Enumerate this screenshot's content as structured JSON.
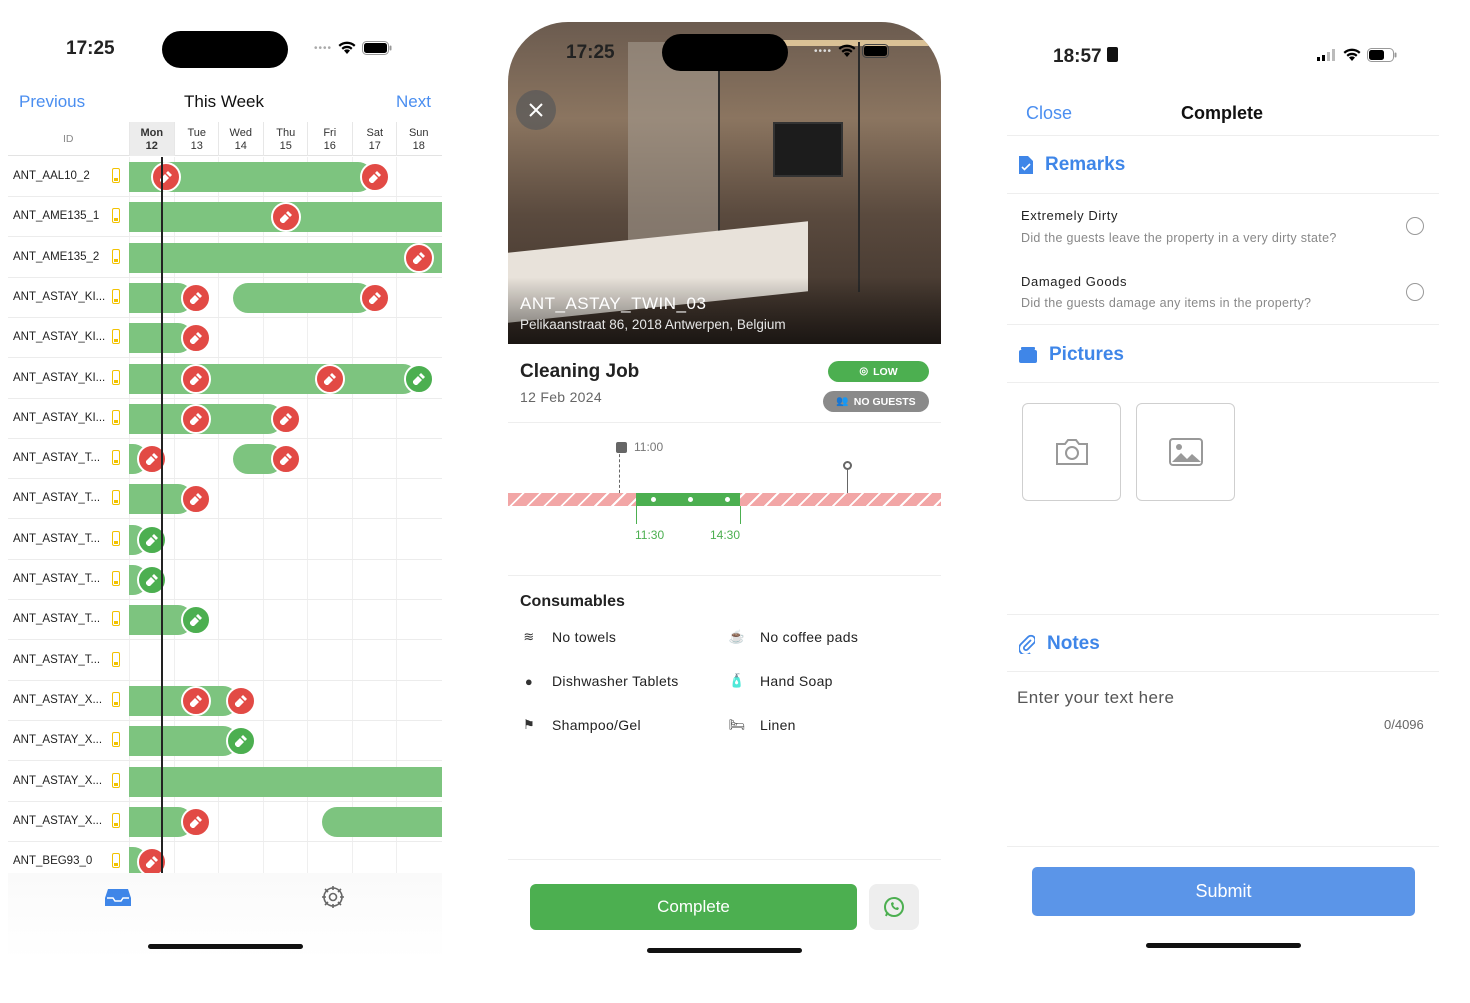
{
  "screen1": {
    "status_time": "17:25",
    "nav": {
      "prev": "Previous",
      "title": "This Week",
      "next": "Next"
    },
    "id_header": "ID",
    "days": [
      {
        "name": "Mon",
        "num": "12"
      },
      {
        "name": "Tue",
        "num": "13"
      },
      {
        "name": "Wed",
        "num": "14"
      },
      {
        "name": "Thu",
        "num": "15"
      },
      {
        "name": "Fri",
        "num": "16"
      },
      {
        "name": "Sat",
        "num": "17"
      },
      {
        "name": "Sun",
        "num": "18"
      }
    ],
    "rows": [
      {
        "id": "ANT_AAL10_2"
      },
      {
        "id": "ANT_AME135_1"
      },
      {
        "id": "ANT_AME135_2"
      },
      {
        "id": "ANT_ASTAY_KI..."
      },
      {
        "id": "ANT_ASTAY_KI..."
      },
      {
        "id": "ANT_ASTAY_KI..."
      },
      {
        "id": "ANT_ASTAY_KI..."
      },
      {
        "id": "ANT_ASTAY_T..."
      },
      {
        "id": "ANT_ASTAY_T..."
      },
      {
        "id": "ANT_ASTAY_T..."
      },
      {
        "id": "ANT_ASTAY_T..."
      },
      {
        "id": "ANT_ASTAY_T..."
      },
      {
        "id": "ANT_ASTAY_T..."
      },
      {
        "id": "ANT_ASTAY_X..."
      },
      {
        "id": "ANT_ASTAY_X..."
      },
      {
        "id": "ANT_ASTAY_X..."
      },
      {
        "id": "ANT_ASTAY_X..."
      },
      {
        "id": "ANT_BEG93_0"
      }
    ],
    "tabs": [
      {
        "icon": "inbox-icon"
      },
      {
        "icon": "gear-icon"
      }
    ]
  },
  "screen2": {
    "status_time": "17:25",
    "property_name": "ANT_ASTAY_TWIN_03",
    "address": "Pelikaanstraat 86, 2018 Antwerpen, Belgium",
    "job_title": "Cleaning Job",
    "job_date": "12 Feb 2024",
    "priority_badge": "LOW",
    "guests_badge": "NO GUESTS",
    "checkout_time": "11:00",
    "window_start": "11:30",
    "window_end": "14:30",
    "consumables_title": "Consumables",
    "consumables": [
      {
        "label": "No towels",
        "icon": "towels-icon"
      },
      {
        "label": "No coffee pads",
        "icon": "coffee-icon"
      },
      {
        "label": "Dishwasher Tablets",
        "icon": "tablets-icon"
      },
      {
        "label": "Hand Soap",
        "icon": "soap-icon"
      },
      {
        "label": "Shampoo/Gel",
        "icon": "shampoo-icon"
      },
      {
        "label": "Linen",
        "icon": "bed-icon"
      }
    ],
    "complete_label": "Complete",
    "colors": {
      "green": "#4caf50",
      "pink": "#f2a6a6"
    }
  },
  "screen3": {
    "status_time": "18:57",
    "nav": {
      "close": "Close",
      "title": "Complete"
    },
    "remarks_title": "Remarks",
    "remarks": [
      {
        "title": "Extremely Dirty",
        "desc": "Did the guests leave the property in a very dirty state?"
      },
      {
        "title": "Damaged Goods",
        "desc": "Did the guests damage any items in the property?"
      }
    ],
    "pictures_title": "Pictures",
    "notes_title": "Notes",
    "notes_placeholder": "Enter your text here",
    "notes_counter": "0/4096",
    "submit_label": "Submit",
    "colors": {
      "accent": "#3f86e8",
      "submit": "#5b95e8"
    }
  }
}
